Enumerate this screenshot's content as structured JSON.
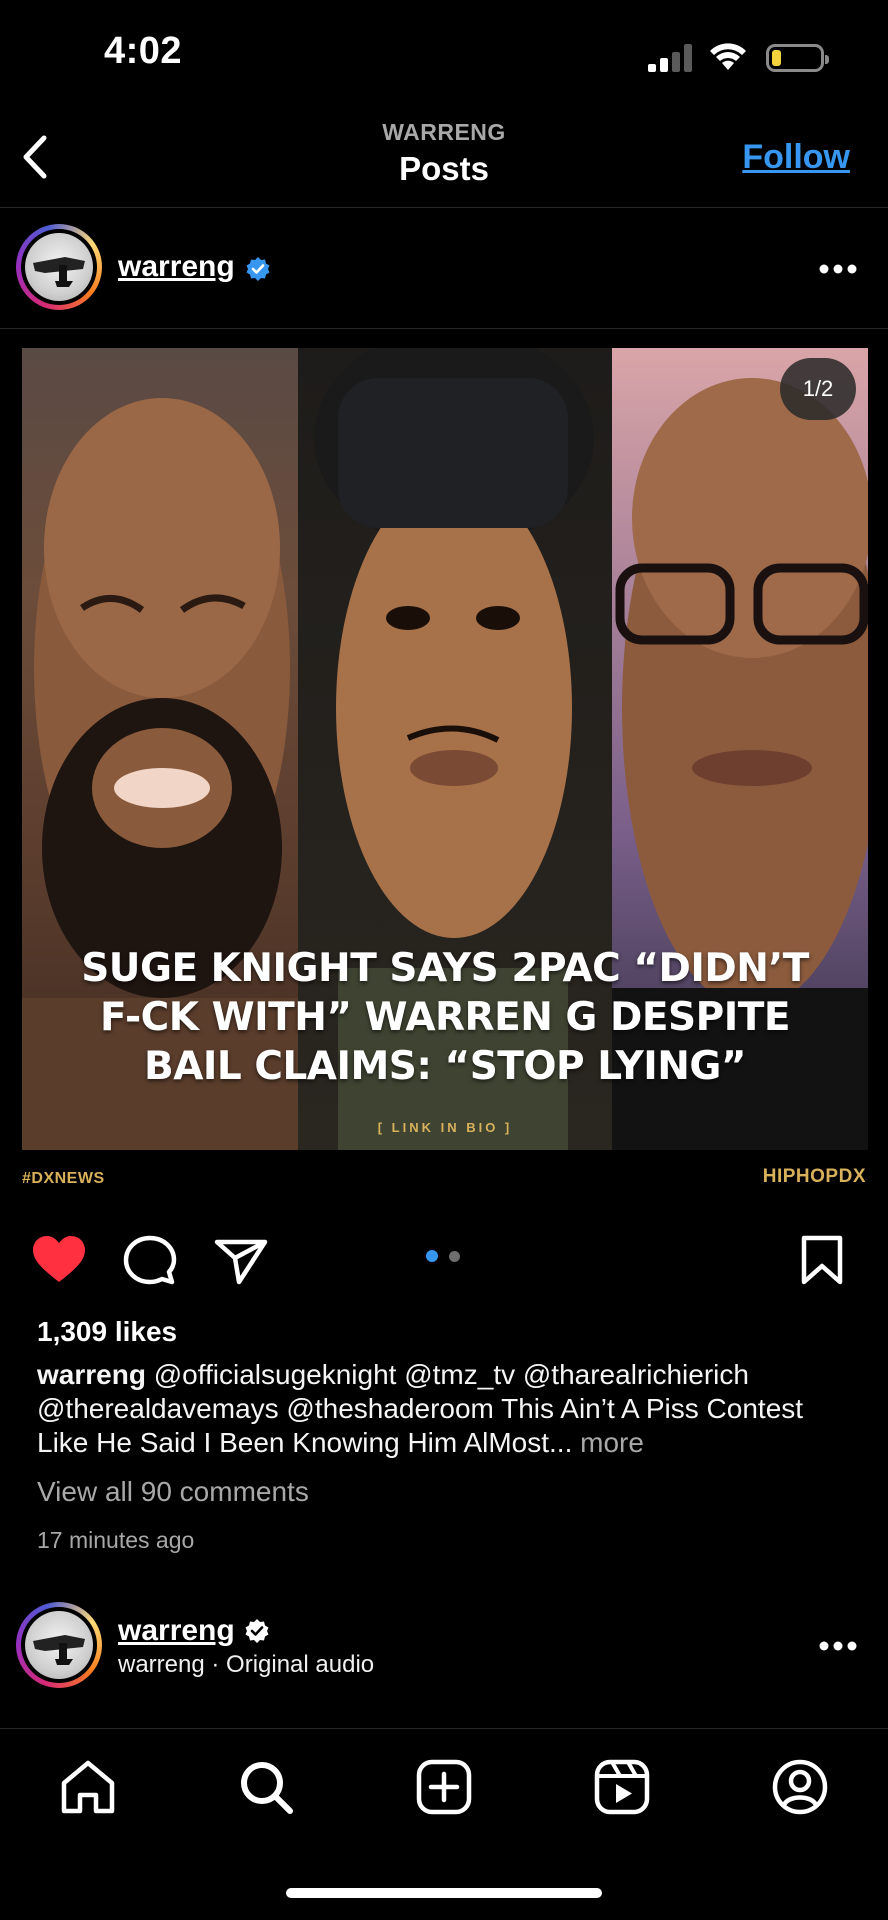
{
  "status_bar": {
    "time": "4:02"
  },
  "nav": {
    "subtitle": "WARRENG",
    "title": "Posts",
    "follow_label": "Follow"
  },
  "post": {
    "username": "warreng",
    "image": {
      "counter": "1/2",
      "headline_line1": "SUGE KNIGHT SAYS 2PAC “DIDN’T",
      "headline_line2": "F-CK WITH” WARREN G DESPITE",
      "headline_line3": "BAIL CLAIMS: “STOP LYING”",
      "link_in_bio": "[ LINK IN BIO ]",
      "hashtag": "#DXNEWS",
      "brand": "HIPHOPDX"
    },
    "carousel": {
      "total": 2,
      "active": 0
    },
    "likes": "1,309 likes",
    "caption_user": "warreng",
    "caption_text": " @officialsugeknight @tmz_tv @tharealrichierich @therealdavemays @theshaderoom This Ain’t A Piss Contest Like He Said I Been Knowing Him AlMost...",
    "caption_more": " more",
    "view_comments": "View all 90 comments",
    "time_ago": "17 minutes ago"
  },
  "next_post": {
    "username": "warreng",
    "audio": "warreng · Original audio"
  },
  "icons": {
    "back": "chevron-left-icon",
    "verified": "verified-badge-icon",
    "more": "more-horizontal-icon",
    "like": "heart-filled-icon",
    "comment": "comment-icon",
    "share": "send-icon",
    "save": "bookmark-icon",
    "tabs": [
      "home-icon",
      "search-icon",
      "create-icon",
      "reels-icon",
      "profile-icon"
    ]
  },
  "colors": {
    "accent": "#3797f0",
    "like": "#ff3040",
    "brand_gold": "#d8b15a"
  }
}
